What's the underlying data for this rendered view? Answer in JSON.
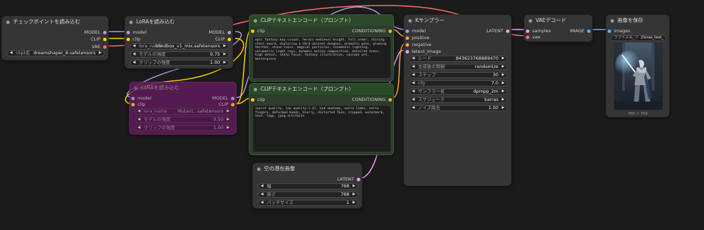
{
  "colors": {
    "canvas_bg": "#1b1b1b",
    "model": "#b39ddb",
    "clip": "#ffd500",
    "vae": "#ff6e6e",
    "conditioning": "#ffa931",
    "latent": "#ff9cf9",
    "image": "#64b5f6",
    "bypass": "#5e1b5a",
    "prompt_green": "#2c3d2c"
  },
  "checkpoint": {
    "title": "チェックポイントを読み込む",
    "outputs": [
      "MODEL",
      "CLIP",
      "VAE"
    ],
    "widget_label": "ckpt名",
    "widget_value": "dreamshaper_8.safetensors"
  },
  "lora1": {
    "title": "LoRAを読み込む",
    "inputs": [
      "model",
      "clip"
    ],
    "outputs": [
      "MODEL",
      "CLIP"
    ],
    "widgets": [
      {
        "label": "lora_name",
        "value": "blindbox_v1_mix.safetensors"
      },
      {
        "label": "モデルの強度",
        "value": "0.75"
      },
      {
        "label": "クリップの強度",
        "value": "1.00"
      }
    ]
  },
  "lora2": {
    "title": "LoRAを読み込む",
    "inputs": [
      "model",
      "clip"
    ],
    "outputs": [
      "MODEL",
      "CLIP"
    ],
    "widgets": [
      {
        "label": "lora_name",
        "value": "Mutant...safetensors"
      },
      {
        "label": "モデルの強度",
        "value": "0.50"
      },
      {
        "label": "クリップの強度",
        "value": "1.00"
      }
    ]
  },
  "clip_pos": {
    "title": "CLIPテキストエンコード（プロンプト）",
    "input": "clip",
    "output": "CONDITIONING",
    "text": "epic fantasy key visual, heroic medieval knight, full armor, shining steel sword, exploring a dark ancient dungeon, dramatic pose, glowing torches, stone ruins, magical particles, cinematic lighting, volumetric light rays, dynamic action composition, detailed armor, high detail, sharp focus, fantasy illustration, concept art, masterpiece"
  },
  "clip_neg": {
    "title": "CLIPテキストエンコード（プロンプト）",
    "input": "clip",
    "output": "CONDITIONING",
    "text": "(worst quality, low quality:1.4), bad anatomy, extra limbs, extra fingers, deformed hands, blurry, distorted face, cropped, watermark, text, logo, jpeg artifacts"
  },
  "empty_latent": {
    "title": "空の潜在画像",
    "output": "LATENT",
    "widgets": [
      {
        "label": "幅",
        "value": "768"
      },
      {
        "label": "高さ",
        "value": "768"
      },
      {
        "label": "バッチサイズ",
        "value": "1"
      }
    ]
  },
  "ksampler": {
    "title": "Kサンプラー",
    "inputs": [
      "model",
      "positive",
      "negative",
      "latent_image"
    ],
    "output": "LATENT",
    "widgets": [
      {
        "label": "シード",
        "value": "843623768889470"
      },
      {
        "label": "生成後の制御",
        "value": "randomize"
      },
      {
        "label": "ステップ",
        "value": "30"
      },
      {
        "label": "cfg",
        "value": "7.0"
      },
      {
        "label": "サンプラー名",
        "value": "dpmpp_2m"
      },
      {
        "label": "スケジューラ",
        "value": "karras"
      },
      {
        "label": "ノイズ除去",
        "value": "1.00"
      }
    ]
  },
  "vae_decode": {
    "title": "VAEデコード",
    "inputs": [
      "samples",
      "vae"
    ],
    "output": "IMAGE"
  },
  "save_image": {
    "title": "画像を保存",
    "input": "images",
    "widget_label": "ファイル名_プレフィ...",
    "widget_value": "2loras_test_",
    "preview_caption": "768 × 768"
  }
}
